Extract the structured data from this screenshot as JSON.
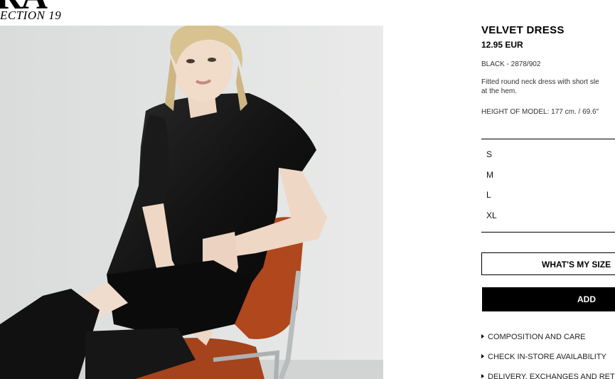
{
  "brand": {
    "logo_fragment": "RA",
    "collection": "ECTION 19"
  },
  "product": {
    "title": "VELVET DRESS",
    "price": "12.95 EUR",
    "color_ref": "BLACK - 2878/902",
    "description_line1": "Fitted round neck dress with short sle",
    "description_line2": "at the hem.",
    "model_height": "HEIGHT OF MODEL: 177 cm. / 69.6″"
  },
  "sizes": [
    "S",
    "M",
    "L",
    "XL"
  ],
  "buttons": {
    "size_guide": "WHAT'S MY SIZE",
    "add": "ADD"
  },
  "info_links": [
    "COMPOSITION AND CARE",
    "CHECK IN-STORE AVAILABILITY",
    "DELIVERY, EXCHANGES AND RETU"
  ],
  "colors": {
    "background": "#ffffff",
    "text": "#000000",
    "add_button": "#000000",
    "chair_seat": "#b0471d"
  }
}
